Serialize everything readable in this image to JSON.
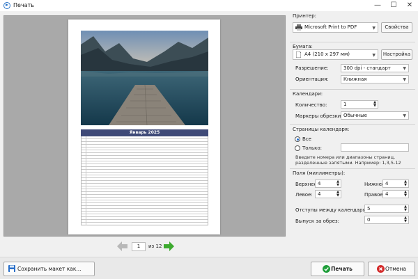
{
  "window": {
    "title": "Печать",
    "controls": {
      "minimize": "—",
      "maximize": "☐",
      "close": "✕"
    }
  },
  "preview": {
    "calendar_title": "Январь 2025",
    "pagination": {
      "current": "1",
      "of_label": "из 12"
    }
  },
  "printer": {
    "group_label": "Принтер:",
    "selected": "Microsoft Print to PDF",
    "properties_button": "Свойства"
  },
  "paper": {
    "group_label": "Бумага:",
    "size": "А4 (210 x 297 мм)",
    "setup_button": "Настройка",
    "resolution_label": "Разрешение:",
    "resolution_value": "300 dpi - стандарт",
    "orientation_label": "Ориентация:",
    "orientation_value": "Книжная"
  },
  "calendars": {
    "group_label": "Календари:",
    "count_label": "Количество:",
    "count_value": "1",
    "crop_marks_label": "Маркеры обрезки:",
    "crop_marks_value": "Обычные"
  },
  "pages": {
    "group_label": "Страницы календаря:",
    "all_label": "Все",
    "only_label": "Только:",
    "only_value": "",
    "hint": "Введите номера или диапазоны страниц, разделенные запятыми. Например: 1,3,5-12"
  },
  "margins": {
    "group_label": "Поля (миллиметры):",
    "top_label": "Верхнее:",
    "top_value": "4",
    "bottom_label": "Нижнее:",
    "bottom_value": "4",
    "left_label": "Левое:",
    "left_value": "4",
    "right_label": "Правое:",
    "right_value": "4",
    "gap_label": "Отступы между календарями:",
    "gap_value": "5",
    "bleed_label": "Выпуск за обрез:",
    "bleed_value": "0"
  },
  "footer": {
    "save_layout": "Сохранить макет как...",
    "print": "Печать",
    "cancel": "Отмена"
  },
  "colors": {
    "calendar_header": "#3f4a78",
    "accent_blue": "#1f6fd0",
    "print_green": "#1f9e3a",
    "cancel_red": "#d42a2a"
  }
}
